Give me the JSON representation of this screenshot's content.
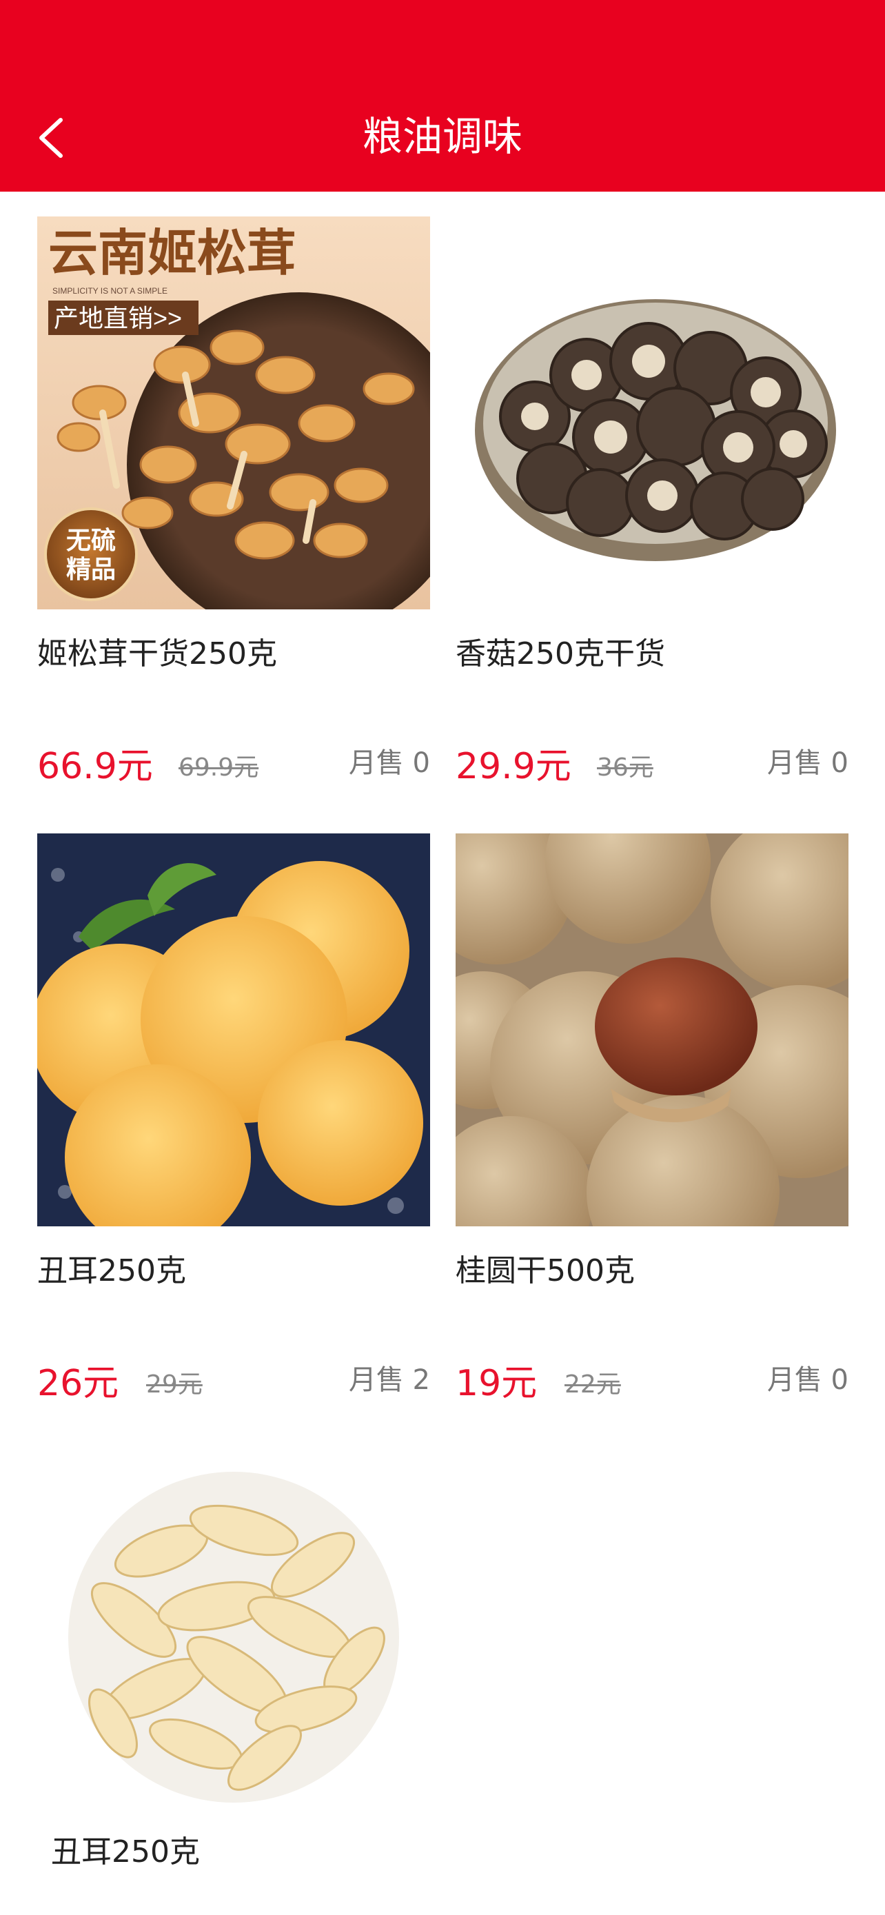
{
  "header": {
    "title": "粮油调味",
    "back_icon": "chevron-left-icon"
  },
  "colors": {
    "brand": "#e8011f",
    "price": "#e8122d"
  },
  "products": [
    {
      "name": "姬松茸干货250克",
      "price": "66.9元",
      "original_price": "69.9元",
      "sales": "月售 0",
      "image_text": {
        "headline": "云南姬松茸",
        "tagline": "SIMPLICITY IS NOT A SIMPLE",
        "promo": "产地直销>>",
        "badge_line1": "无硫",
        "badge_line2": "精品"
      }
    },
    {
      "name": "香菇250克干货",
      "price": "29.9元",
      "original_price": "36元",
      "sales": "月售 0"
    },
    {
      "name": "丑耳250克",
      "price": "26元",
      "original_price": "29元",
      "sales": "月售 2"
    },
    {
      "name": "桂圆干500克",
      "price": "19元",
      "original_price": "22元",
      "sales": "月售 0"
    },
    {
      "name": "丑耳250克"
    }
  ]
}
